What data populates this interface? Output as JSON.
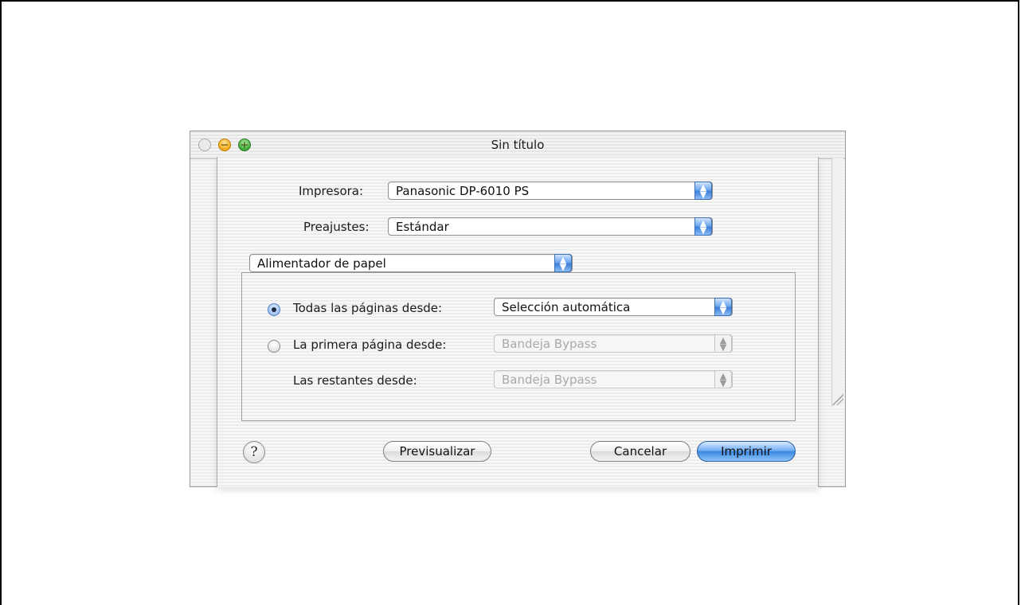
{
  "window": {
    "title": "Sin título"
  },
  "dialog": {
    "printer_label": "Impresora:",
    "printer_value": "Panasonic DP-6010 PS",
    "presets_label": "Preajustes:",
    "presets_value": "Estándar",
    "panel_value": "Alimentador de papel",
    "all_pages_label": "Todas las páginas desde:",
    "all_pages_value": "Selección automática",
    "first_page_label": "La primera página desde:",
    "first_page_value": "Bandeja Bypass",
    "remaining_label": "Las restantes desde:",
    "remaining_value": "Bandeja Bypass",
    "all_pages_selected": true
  },
  "buttons": {
    "help": "?",
    "preview": "Previsualizar",
    "cancel": "Cancelar",
    "print": "Imprimir"
  },
  "icons": {
    "close": "close-icon",
    "minimize": "minimize-icon",
    "zoom": "zoom-icon",
    "popup_arrows": "up-down-arrows-icon",
    "resize": "resize-grip-icon"
  },
  "colors": {
    "accent": "#3b7fdb",
    "desktop": "#5a7bab"
  }
}
